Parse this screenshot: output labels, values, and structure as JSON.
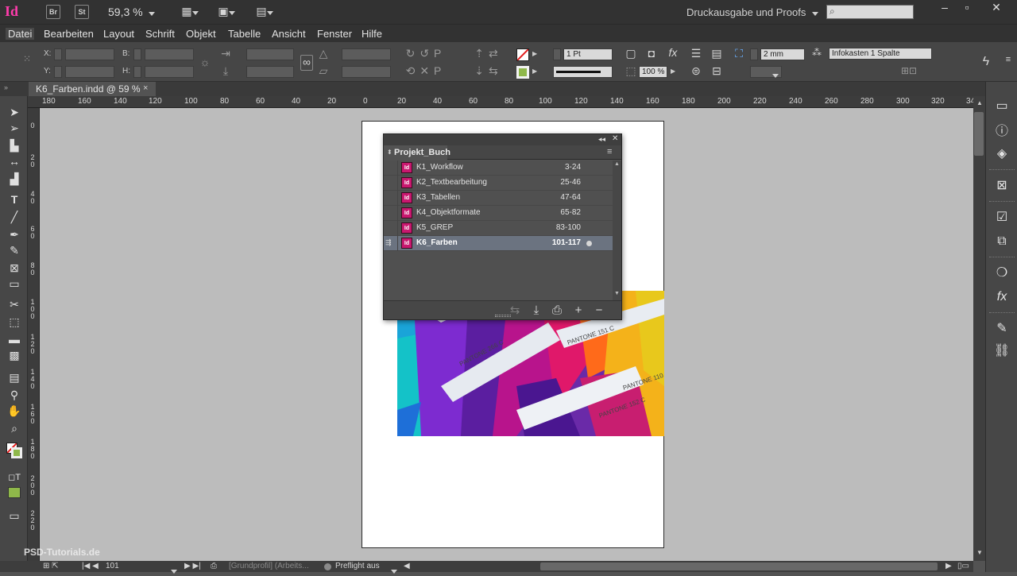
{
  "app": {
    "logo": "Id",
    "bridge_label": "Br",
    "stock_label": "St",
    "zoom": "59,3 %",
    "workspace": "Druckausgabe und Proofs",
    "search_placeholder": ""
  },
  "menu": [
    "Datei",
    "Bearbeiten",
    "Layout",
    "Schrift",
    "Objekt",
    "Tabelle",
    "Ansicht",
    "Fenster",
    "Hilfe"
  ],
  "control": {
    "x_label": "X:",
    "y_label": "Y:",
    "b_label": "B:",
    "h_label": "H:",
    "stroke_weight": "1 Pt",
    "opacity": "100 %",
    "offset": "2 mm",
    "object_style": "Infokasten 1 Spalte"
  },
  "document_tab": {
    "title": "K6_Farben.indd @ 59 %",
    "close": "×"
  },
  "ruler": {
    "h_ticks": [
      "180",
      "160",
      "140",
      "120",
      "100",
      "80",
      "60",
      "40",
      "20",
      "0",
      "20",
      "40",
      "60",
      "80",
      "100",
      "120",
      "140",
      "160",
      "180",
      "200",
      "220",
      "240",
      "260",
      "280",
      "300",
      "320",
      "340"
    ],
    "v_ticks": [
      "0",
      "2 0",
      "4 0",
      "6 0",
      "8 0",
      "1 0 0",
      "1 2 0",
      "1 4 0",
      "1 6 0",
      "1 8 0",
      "2 0 0",
      "2 2 0",
      "2 4 0",
      "2 6 0"
    ]
  },
  "book_panel": {
    "tab": "Projekt_Buch",
    "rows": [
      {
        "name": "K1_Workflow",
        "pages": "3-24"
      },
      {
        "name": "K2_Textbearbeitung",
        "pages": "25-46"
      },
      {
        "name": "K3_Tabellen",
        "pages": "47-64"
      },
      {
        "name": "K4_Objektformate",
        "pages": "65-82"
      },
      {
        "name": "K5_GREP",
        "pages": "83-100"
      },
      {
        "name": "K6_Farben",
        "pages": "101-117"
      }
    ],
    "selected_index": 5,
    "doc_icon_label": "Id"
  },
  "status": {
    "page": "101",
    "profile": "[Grundprofil] (Arbeits...",
    "preflight": "Preflight aus"
  },
  "image_labels": [
    "PANTONE 151 C",
    "PANTONE 110 C",
    "PANTONE 152 C",
    "PANTONE 266 C"
  ],
  "watermark": "PSD-Tutorials.de",
  "colors": {
    "accent_magenta": "#ff3cac",
    "selection": "#6b7380",
    "fill_green": "#8fb84a"
  }
}
